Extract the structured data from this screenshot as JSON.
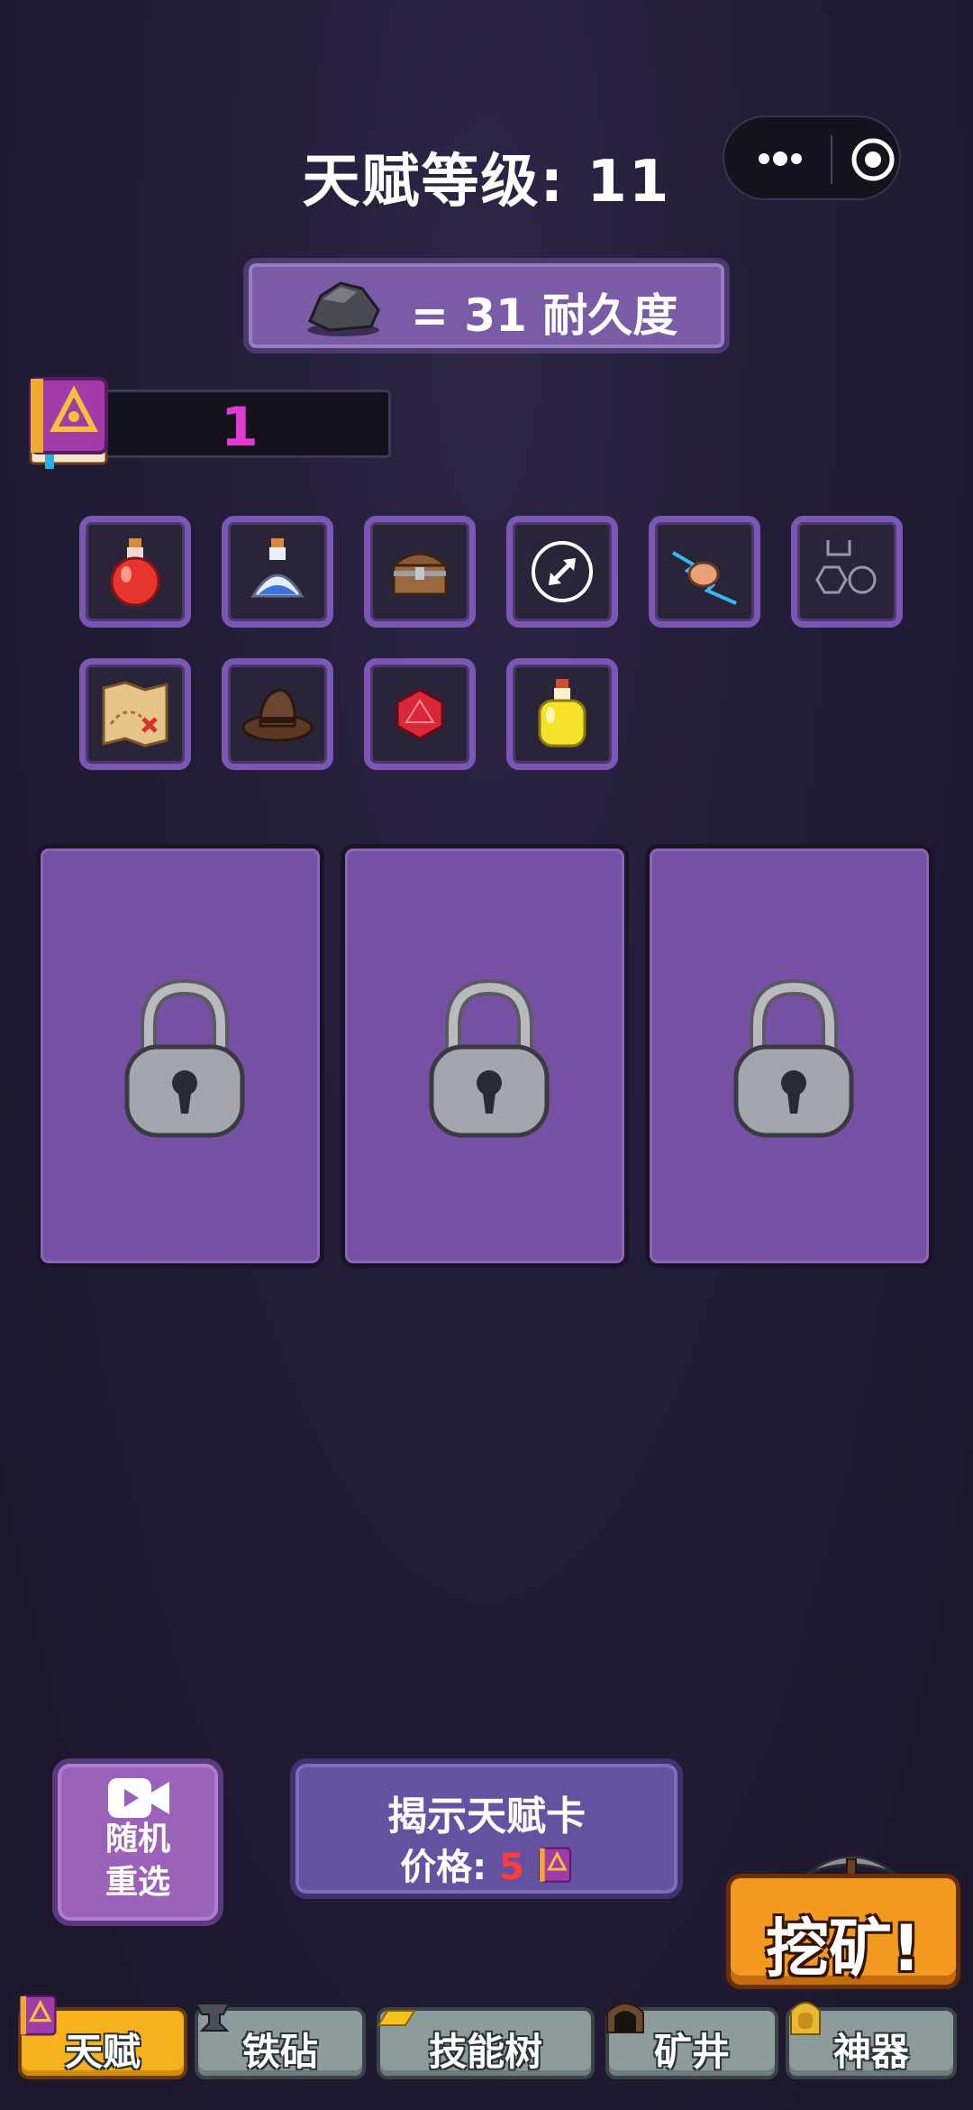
{
  "header": {
    "title": "天赋等级: 11"
  },
  "durability": {
    "text": "= 31 耐久度",
    "icon": "rock-icon"
  },
  "book_progress": {
    "value": "1"
  },
  "talents": [
    {
      "icon": "red-potion-icon"
    },
    {
      "icon": "blue-potion-icon"
    },
    {
      "icon": "treasure-chest-icon"
    },
    {
      "icon": "expand-arrow-icon"
    },
    {
      "icon": "lightning-fist-icon"
    },
    {
      "icon": "hexagon-molecule-icon"
    },
    {
      "icon": "treasure-map-icon"
    },
    {
      "icon": "fedora-hat-icon"
    },
    {
      "icon": "red-d20-dice-icon"
    },
    {
      "icon": "yellow-potion-icon"
    }
  ],
  "cards": [
    {
      "state": "locked"
    },
    {
      "state": "locked"
    },
    {
      "state": "locked"
    }
  ],
  "reroll": {
    "line1": "随机",
    "line2": "重选"
  },
  "reveal": {
    "title": "揭示天赋卡",
    "price_label": "价格:",
    "price": "5"
  },
  "mine_button": {
    "label": "挖矿!"
  },
  "tabs": [
    {
      "label": "天赋",
      "active": true
    },
    {
      "label": "铁砧",
      "active": false
    },
    {
      "label": "技能树",
      "active": false
    },
    {
      "label": "矿井",
      "active": false
    },
    {
      "label": "神器",
      "active": false
    }
  ],
  "colors": {
    "accent": "#7b56b4",
    "progress_text": "#e23bd4",
    "mine_orange": "#f19a1f",
    "tab_active": "#f5b21c"
  }
}
